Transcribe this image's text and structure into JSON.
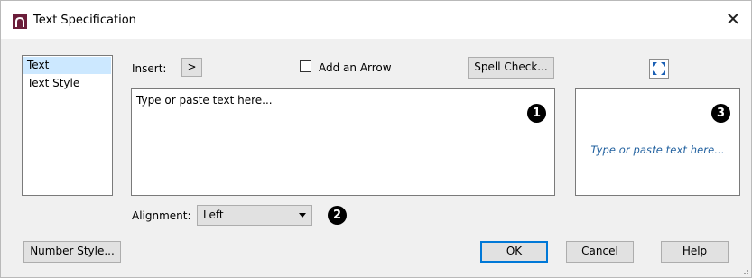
{
  "window": {
    "title": "Text Specification",
    "close_glyph": "✕"
  },
  "nav": {
    "items": [
      {
        "label": "Text",
        "selected": true
      },
      {
        "label": "Text Style",
        "selected": false
      }
    ]
  },
  "toolbar": {
    "insert_label": "Insert:",
    "insert_button": ">",
    "add_arrow_label": "Add an Arrow",
    "add_arrow_checked": false,
    "spell_check_label": "Spell Check..."
  },
  "editor": {
    "placeholder": "Type or paste text here..."
  },
  "preview": {
    "text": "Type or paste text here...",
    "color": "#1f5f9e"
  },
  "callouts": [
    "1",
    "2",
    "3"
  ],
  "alignment": {
    "label": "Alignment:",
    "value": "Left"
  },
  "buttons": {
    "number_style": "Number Style...",
    "ok": "OK",
    "cancel": "Cancel",
    "help": "Help"
  },
  "icons": {
    "app": "text-spec-app-icon",
    "fullscreen": "fullscreen-icon"
  },
  "colors": {
    "selection": "#cce8ff",
    "accent": "#0078d7",
    "app_icon_fill": "#6b1d3a"
  }
}
